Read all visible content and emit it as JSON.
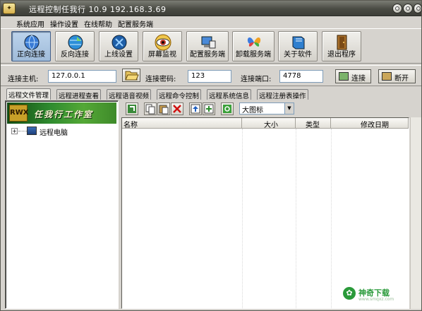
{
  "window": {
    "title": "远程控制任我行 10.9   192.168.3.69"
  },
  "menu": [
    "系统应用",
    "操作设置",
    "在线帮助",
    "配置服务端"
  ],
  "toolbar": [
    {
      "label": "正向连接",
      "icon": "globe-connect-icon",
      "active": true
    },
    {
      "label": "反向连接",
      "icon": "globe-reverse-icon",
      "active": false
    },
    {
      "label": "上线设置",
      "icon": "globe-settings-icon",
      "active": false
    },
    {
      "label": "屏幕监视",
      "icon": "eye-icon",
      "active": false
    },
    {
      "label": "配置服务端",
      "icon": "computer-config-icon",
      "active": false
    },
    {
      "label": "卸载服务端",
      "icon": "butterfly-icon",
      "active": false
    },
    {
      "label": "关于软件",
      "icon": "book-icon",
      "active": false
    },
    {
      "label": "退出程序",
      "icon": "door-exit-icon",
      "active": false
    }
  ],
  "connection": {
    "host_label": "连接主机:",
    "host_value": "127.0.0.1",
    "password_label": "连接密码:",
    "password_value": "123",
    "port_label": "连接端口:",
    "port_value": "4778",
    "connect_label": "连接",
    "disconnect_label": "断开"
  },
  "tabs": [
    "远程文件管理",
    "远程进程查看",
    "远程语音视频",
    "远程命令控制",
    "远程系统信息",
    "远程注册表操作"
  ],
  "left": {
    "banner_text": "任我行工作室",
    "banner_logo": "RWX",
    "tree_expander": "+",
    "tree_item": "远程电脑"
  },
  "file_view": {
    "view_mode": "大图标",
    "columns": [
      "名称",
      "大小",
      "类型",
      "修改日期"
    ]
  },
  "watermark": {
    "text": "神奇下载",
    "sub": "www.smqxz.com"
  }
}
